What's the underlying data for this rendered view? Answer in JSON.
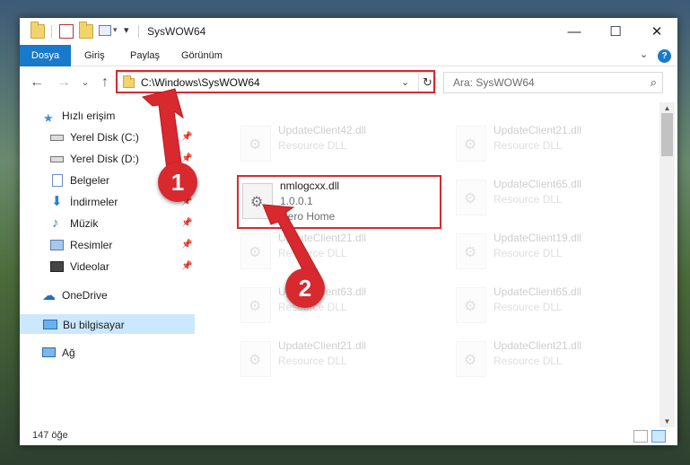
{
  "window": {
    "title": "SysWOW64",
    "minimize": "—",
    "maximize": "☐",
    "close": "✕"
  },
  "ribbon": {
    "tabs": [
      {
        "label": "Dosya"
      },
      {
        "label": "Giriş"
      },
      {
        "label": "Paylaş"
      },
      {
        "label": "Görünüm"
      }
    ],
    "help": "?"
  },
  "nav": {
    "back": "←",
    "forward": "→",
    "recent": "⌄",
    "up": "↑",
    "address": "C:\\Windows\\SysWOW64",
    "refresh": "↻",
    "search_placeholder": "Ara: SysWOW64"
  },
  "sidebar": {
    "items": [
      {
        "label": "Hızlı erişim",
        "icon": "star-icon"
      },
      {
        "label": "Yerel Disk (C:)",
        "icon": "drive-icon",
        "pinned": true
      },
      {
        "label": "Yerel Disk (D:)",
        "icon": "drive-icon",
        "pinned": true
      },
      {
        "label": "Belgeler",
        "icon": "documents-icon",
        "pinned": true
      },
      {
        "label": "İndirmeler",
        "icon": "downloads-icon",
        "pinned": true
      },
      {
        "label": "Müzik",
        "icon": "music-icon",
        "pinned": true
      },
      {
        "label": "Resimler",
        "icon": "pictures-icon",
        "pinned": true
      },
      {
        "label": "Videolar",
        "icon": "videos-icon",
        "pinned": true
      },
      {
        "label": "OneDrive",
        "icon": "cloud-icon"
      },
      {
        "label": "Bu bilgisayar",
        "icon": "computer-icon",
        "selected": true
      },
      {
        "label": "Ağ",
        "icon": "network-icon"
      }
    ]
  },
  "files": {
    "left": [
      {
        "name": "UpdateClient42.dll",
        "sub": "Resource DLL"
      },
      {
        "name": "nmlogcxx.dll",
        "sub": "1.0.0.1",
        "sub2": "Nero Home"
      },
      {
        "name": "UpdateClient21.dll",
        "sub": "Resource DLL"
      },
      {
        "name": "UpdateClient63.dll",
        "sub": "Resource DLL"
      },
      {
        "name": "UpdateClient21.dll",
        "sub": "Resource DLL"
      }
    ],
    "right": [
      {
        "name": "UpdateClient21.dll",
        "sub": "Resource DLL"
      },
      {
        "name": "UpdateClient65.dll",
        "sub": "Resource DLL"
      },
      {
        "name": "UpdateClient19.dll",
        "sub": "Resource DLL"
      },
      {
        "name": "UpdateClient65.dll",
        "sub": "Resource DLL"
      },
      {
        "name": "UpdateClient21.dll",
        "sub": "Resource DLL"
      }
    ]
  },
  "status": {
    "count": "147 öğe"
  },
  "annotations": {
    "step1": "1",
    "step2": "2",
    "color": "#d8292f"
  }
}
